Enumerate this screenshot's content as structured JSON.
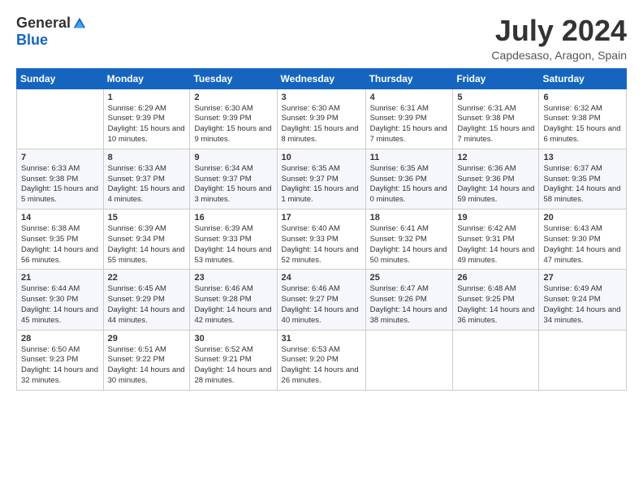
{
  "logo": {
    "general": "General",
    "blue": "Blue"
  },
  "title": "July 2024",
  "location": "Capdesaso, Aragon, Spain",
  "weekdays": [
    "Sunday",
    "Monday",
    "Tuesday",
    "Wednesday",
    "Thursday",
    "Friday",
    "Saturday"
  ],
  "weeks": [
    [
      {
        "day": "",
        "sunrise": "",
        "sunset": "",
        "daylight": ""
      },
      {
        "day": "1",
        "sunrise": "Sunrise: 6:29 AM",
        "sunset": "Sunset: 9:39 PM",
        "daylight": "Daylight: 15 hours and 10 minutes."
      },
      {
        "day": "2",
        "sunrise": "Sunrise: 6:30 AM",
        "sunset": "Sunset: 9:39 PM",
        "daylight": "Daylight: 15 hours and 9 minutes."
      },
      {
        "day": "3",
        "sunrise": "Sunrise: 6:30 AM",
        "sunset": "Sunset: 9:39 PM",
        "daylight": "Daylight: 15 hours and 8 minutes."
      },
      {
        "day": "4",
        "sunrise": "Sunrise: 6:31 AM",
        "sunset": "Sunset: 9:39 PM",
        "daylight": "Daylight: 15 hours and 7 minutes."
      },
      {
        "day": "5",
        "sunrise": "Sunrise: 6:31 AM",
        "sunset": "Sunset: 9:38 PM",
        "daylight": "Daylight: 15 hours and 7 minutes."
      },
      {
        "day": "6",
        "sunrise": "Sunrise: 6:32 AM",
        "sunset": "Sunset: 9:38 PM",
        "daylight": "Daylight: 15 hours and 6 minutes."
      }
    ],
    [
      {
        "day": "7",
        "sunrise": "Sunrise: 6:33 AM",
        "sunset": "Sunset: 9:38 PM",
        "daylight": "Daylight: 15 hours and 5 minutes."
      },
      {
        "day": "8",
        "sunrise": "Sunrise: 6:33 AM",
        "sunset": "Sunset: 9:37 PM",
        "daylight": "Daylight: 15 hours and 4 minutes."
      },
      {
        "day": "9",
        "sunrise": "Sunrise: 6:34 AM",
        "sunset": "Sunset: 9:37 PM",
        "daylight": "Daylight: 15 hours and 3 minutes."
      },
      {
        "day": "10",
        "sunrise": "Sunrise: 6:35 AM",
        "sunset": "Sunset: 9:37 PM",
        "daylight": "Daylight: 15 hours and 1 minute."
      },
      {
        "day": "11",
        "sunrise": "Sunrise: 6:35 AM",
        "sunset": "Sunset: 9:36 PM",
        "daylight": "Daylight: 15 hours and 0 minutes."
      },
      {
        "day": "12",
        "sunrise": "Sunrise: 6:36 AM",
        "sunset": "Sunset: 9:36 PM",
        "daylight": "Daylight: 14 hours and 59 minutes."
      },
      {
        "day": "13",
        "sunrise": "Sunrise: 6:37 AM",
        "sunset": "Sunset: 9:35 PM",
        "daylight": "Daylight: 14 hours and 58 minutes."
      }
    ],
    [
      {
        "day": "14",
        "sunrise": "Sunrise: 6:38 AM",
        "sunset": "Sunset: 9:35 PM",
        "daylight": "Daylight: 14 hours and 56 minutes."
      },
      {
        "day": "15",
        "sunrise": "Sunrise: 6:39 AM",
        "sunset": "Sunset: 9:34 PM",
        "daylight": "Daylight: 14 hours and 55 minutes."
      },
      {
        "day": "16",
        "sunrise": "Sunrise: 6:39 AM",
        "sunset": "Sunset: 9:33 PM",
        "daylight": "Daylight: 14 hours and 53 minutes."
      },
      {
        "day": "17",
        "sunrise": "Sunrise: 6:40 AM",
        "sunset": "Sunset: 9:33 PM",
        "daylight": "Daylight: 14 hours and 52 minutes."
      },
      {
        "day": "18",
        "sunrise": "Sunrise: 6:41 AM",
        "sunset": "Sunset: 9:32 PM",
        "daylight": "Daylight: 14 hours and 50 minutes."
      },
      {
        "day": "19",
        "sunrise": "Sunrise: 6:42 AM",
        "sunset": "Sunset: 9:31 PM",
        "daylight": "Daylight: 14 hours and 49 minutes."
      },
      {
        "day": "20",
        "sunrise": "Sunrise: 6:43 AM",
        "sunset": "Sunset: 9:30 PM",
        "daylight": "Daylight: 14 hours and 47 minutes."
      }
    ],
    [
      {
        "day": "21",
        "sunrise": "Sunrise: 6:44 AM",
        "sunset": "Sunset: 9:30 PM",
        "daylight": "Daylight: 14 hours and 45 minutes."
      },
      {
        "day": "22",
        "sunrise": "Sunrise: 6:45 AM",
        "sunset": "Sunset: 9:29 PM",
        "daylight": "Daylight: 14 hours and 44 minutes."
      },
      {
        "day": "23",
        "sunrise": "Sunrise: 6:46 AM",
        "sunset": "Sunset: 9:28 PM",
        "daylight": "Daylight: 14 hours and 42 minutes."
      },
      {
        "day": "24",
        "sunrise": "Sunrise: 6:46 AM",
        "sunset": "Sunset: 9:27 PM",
        "daylight": "Daylight: 14 hours and 40 minutes."
      },
      {
        "day": "25",
        "sunrise": "Sunrise: 6:47 AM",
        "sunset": "Sunset: 9:26 PM",
        "daylight": "Daylight: 14 hours and 38 minutes."
      },
      {
        "day": "26",
        "sunrise": "Sunrise: 6:48 AM",
        "sunset": "Sunset: 9:25 PM",
        "daylight": "Daylight: 14 hours and 36 minutes."
      },
      {
        "day": "27",
        "sunrise": "Sunrise: 6:49 AM",
        "sunset": "Sunset: 9:24 PM",
        "daylight": "Daylight: 14 hours and 34 minutes."
      }
    ],
    [
      {
        "day": "28",
        "sunrise": "Sunrise: 6:50 AM",
        "sunset": "Sunset: 9:23 PM",
        "daylight": "Daylight: 14 hours and 32 minutes."
      },
      {
        "day": "29",
        "sunrise": "Sunrise: 6:51 AM",
        "sunset": "Sunset: 9:22 PM",
        "daylight": "Daylight: 14 hours and 30 minutes."
      },
      {
        "day": "30",
        "sunrise": "Sunrise: 6:52 AM",
        "sunset": "Sunset: 9:21 PM",
        "daylight": "Daylight: 14 hours and 28 minutes."
      },
      {
        "day": "31",
        "sunrise": "Sunrise: 6:53 AM",
        "sunset": "Sunset: 9:20 PM",
        "daylight": "Daylight: 14 hours and 26 minutes."
      },
      {
        "day": "",
        "sunrise": "",
        "sunset": "",
        "daylight": ""
      },
      {
        "day": "",
        "sunrise": "",
        "sunset": "",
        "daylight": ""
      },
      {
        "day": "",
        "sunrise": "",
        "sunset": "",
        "daylight": ""
      }
    ]
  ]
}
